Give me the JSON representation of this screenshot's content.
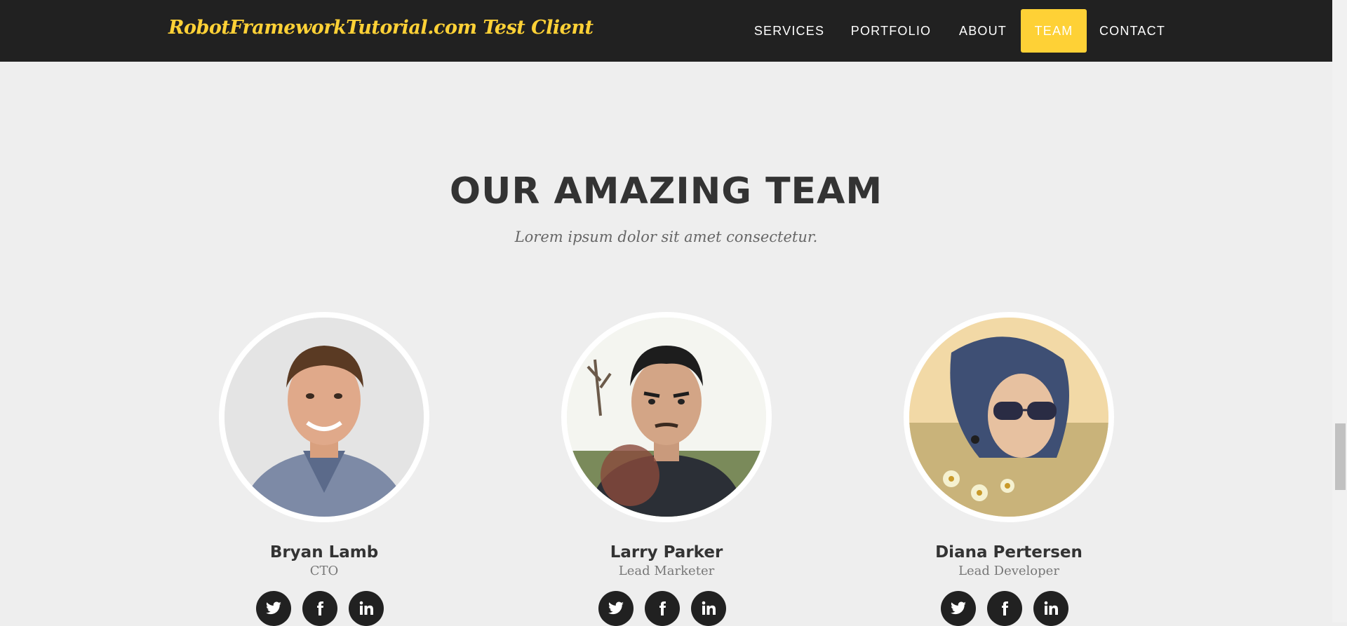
{
  "navbar": {
    "brand": "RobotFrameworkTutorial.com Test Client",
    "items": [
      {
        "label": "SERVICES",
        "active": false
      },
      {
        "label": "PORTFOLIO",
        "active": false
      },
      {
        "label": "ABOUT",
        "active": false
      },
      {
        "label": "TEAM",
        "active": true
      },
      {
        "label": "CONTACT",
        "active": false
      }
    ]
  },
  "team": {
    "heading": "OUR AMAZING TEAM",
    "subheading": "Lorem ipsum dolor sit amet consectetur.",
    "members": [
      {
        "name": "Bryan Lamb",
        "role": "CTO",
        "socials": [
          "twitter-icon",
          "facebook-icon",
          "linkedin-icon"
        ]
      },
      {
        "name": "Larry Parker",
        "role": "Lead Marketer",
        "socials": [
          "twitter-icon",
          "facebook-icon",
          "linkedin-icon"
        ]
      },
      {
        "name": "Diana Pertersen",
        "role": "Lead Developer",
        "socials": [
          "twitter-icon",
          "facebook-icon",
          "linkedin-icon"
        ]
      }
    ]
  },
  "colors": {
    "accent": "#fed136",
    "navbar_bg": "#212121",
    "page_bg": "#eeeeee",
    "heading": "#333333"
  }
}
